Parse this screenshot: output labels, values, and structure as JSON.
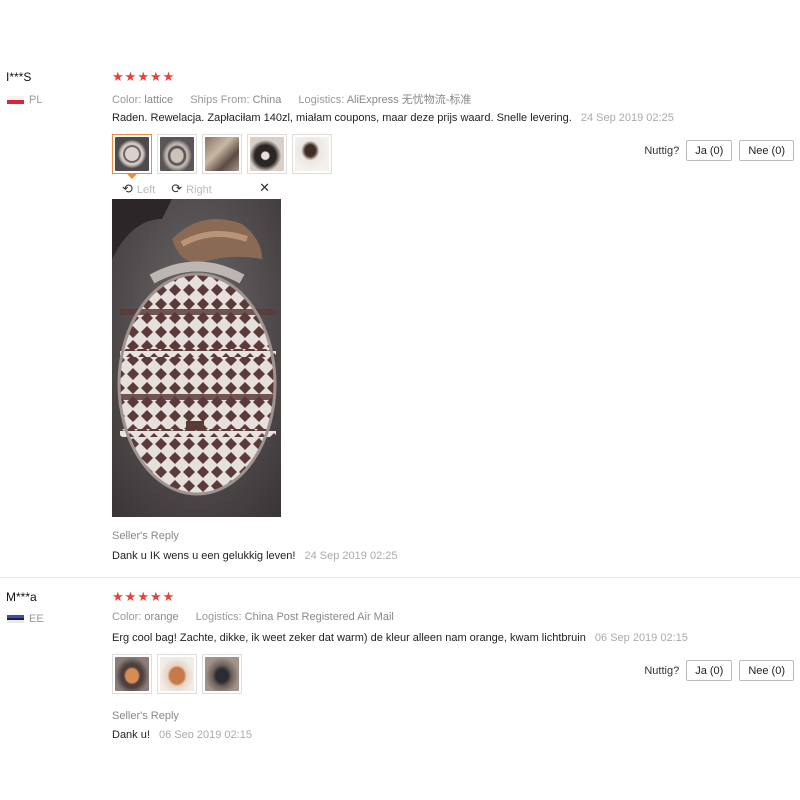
{
  "reviews": [
    {
      "user": "I***S",
      "country": "PL",
      "rating": 5,
      "color_label": "Color:",
      "color_value": "lattice",
      "ships_label": "Ships From:",
      "ships_value": "China",
      "logistics_label": "Logistics:",
      "logistics_value": "AliExpress 无忧物流-标准",
      "text": "Raden. Rewelacja. Zapłaciłam 140zl, miałam coupons, maar deze prijs waard. Snelle levering.",
      "date": "24 Sep 2019 02:25",
      "thumbnail_count": 5,
      "helpful_label": "Nuttig?",
      "yes_label": "Ja (0)",
      "no_label": "Nee (0)",
      "viewer": {
        "left_label": "Left",
        "right_label": "Right",
        "rotate_left_icon": "rotate-left-icon",
        "rotate_right_icon": "rotate-right-icon",
        "close_icon": "close-icon"
      },
      "seller_reply_label": "Seller's Reply",
      "seller_reply_text": "Dank u IK wens u een gelukkig leven!",
      "seller_reply_date": "24 Sep 2019 02:25"
    },
    {
      "user": "M***a",
      "country": "EE",
      "rating": 5,
      "color_label": "Color:",
      "color_value": "orange",
      "logistics_label": "Logistics:",
      "logistics_value": "China Post Registered Air Mail",
      "text": "Erg cool bag! Zachte, dikke, ik weet zeker dat warm) de kleur alleen nam orange, kwam lichtbruin",
      "date": "06 Sep 2019 02:15",
      "thumbnail_count": 3,
      "helpful_label": "Nuttig?",
      "yes_label": "Ja (0)",
      "no_label": "Nee (0)",
      "seller_reply_label": "Seller's Reply",
      "seller_reply_text": "Dank u!",
      "seller_reply_date": "06 Sep 2019 02:15"
    }
  ],
  "icons": {
    "star": "star-icon",
    "flag_pl": "flag-pl-icon",
    "flag_ee": "flag-ee-icon"
  },
  "colors": {
    "star": "#e8413a",
    "active_thumb_border": "#f08a3c",
    "muted_text": "#999999"
  }
}
